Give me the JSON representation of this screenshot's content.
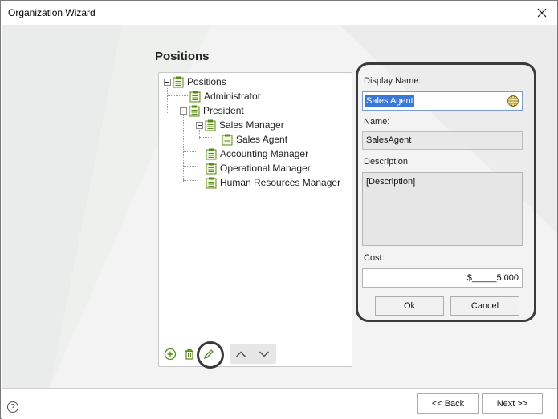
{
  "window": {
    "title": "Organization Wizard"
  },
  "page": {
    "title": "Positions"
  },
  "tree": {
    "nodes": [
      {
        "label": "Positions"
      },
      {
        "label": "Administrator"
      },
      {
        "label": "President"
      },
      {
        "label": "Sales Manager"
      },
      {
        "label": "Sales Agent"
      },
      {
        "label": "Accounting Manager"
      },
      {
        "label": "Operational Manager"
      },
      {
        "label": "Human Resources Manager"
      }
    ]
  },
  "props": {
    "display_name_label": "Display Name:",
    "display_name_value": "Sales Agent",
    "name_label": "Name:",
    "name_value": "SalesAgent",
    "description_label": "Description:",
    "description_value": "[Description]",
    "cost_label": "Cost:",
    "cost_value": "$_____5.000"
  },
  "buttons": {
    "ok": "Ok",
    "cancel": "Cancel",
    "back": "<< Back",
    "next": "Next >>"
  },
  "footer": {
    "help": "?"
  },
  "colors": {
    "accent": "#3a78d8",
    "icon_green": "#5a8a1e",
    "highlight": "#3a3a3a"
  }
}
